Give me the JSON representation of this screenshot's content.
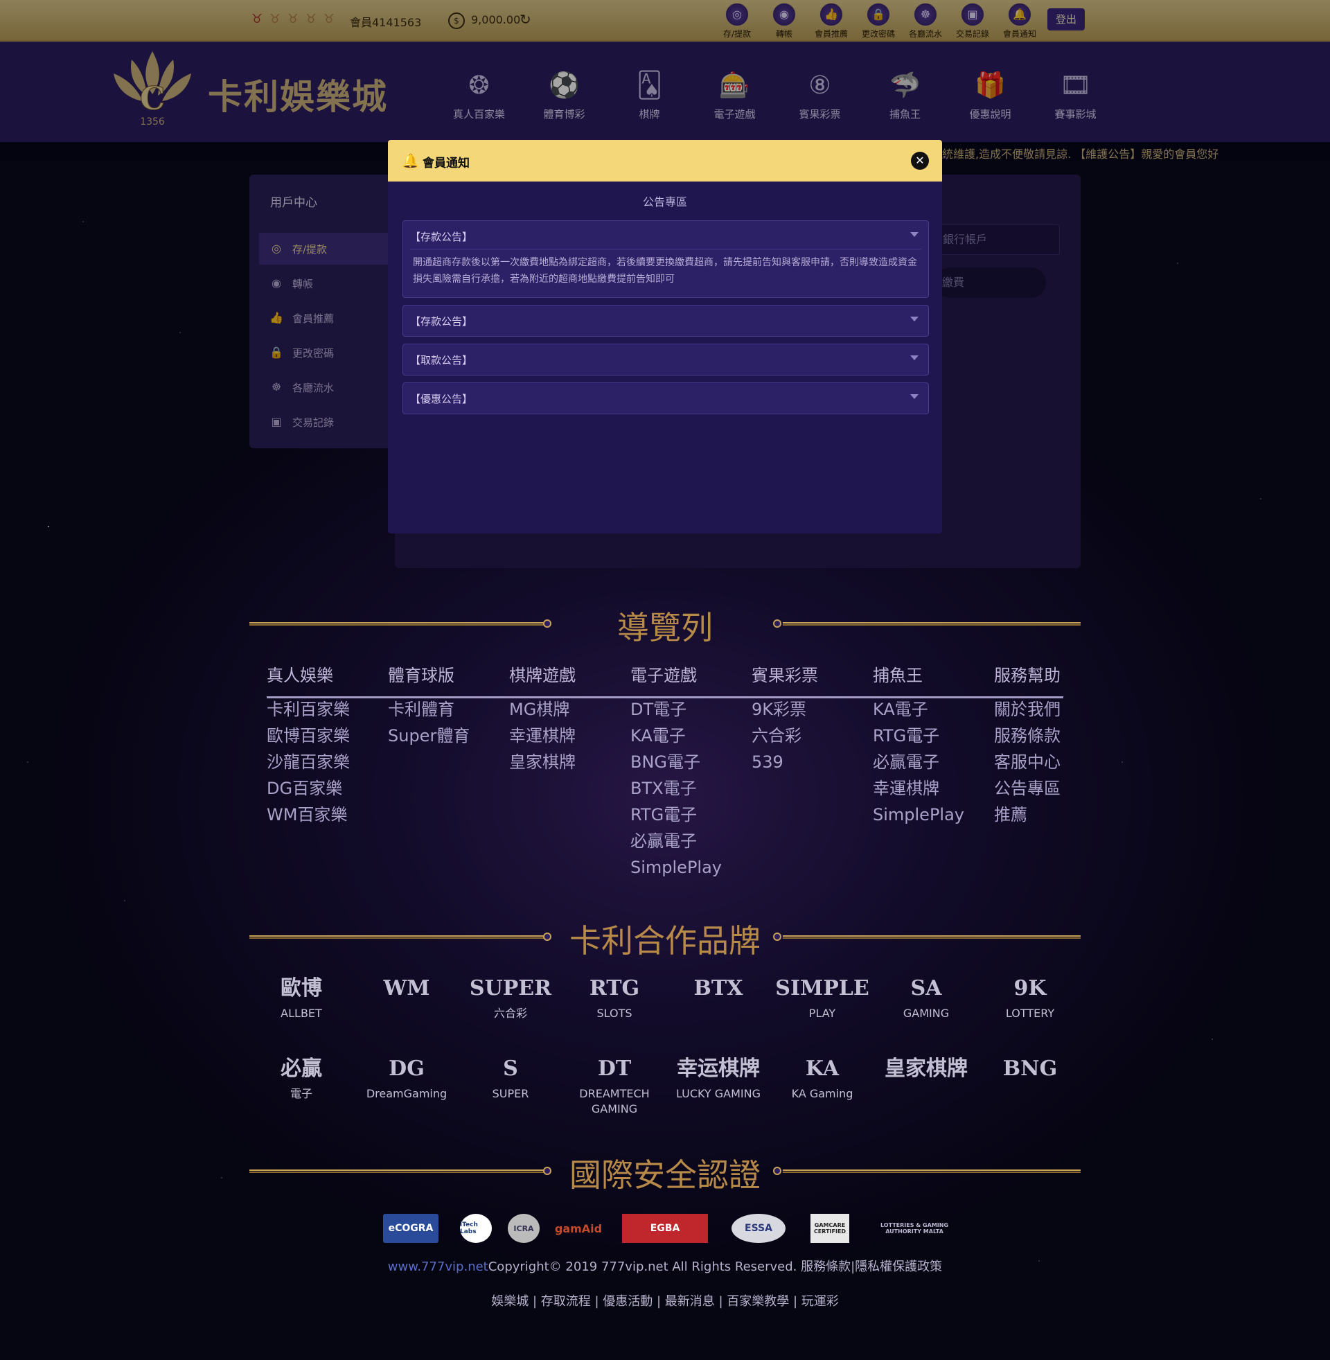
{
  "topbar": {
    "medals": [
      "♉",
      "♉",
      "♉",
      "♉",
      "♉"
    ],
    "member_id": "會員4141563",
    "balance_icon": "coin-icon",
    "balance": "9,000.00",
    "nav": [
      {
        "label": "存/提款",
        "icon": "deposit-icon",
        "glyph": "◎"
      },
      {
        "label": "轉帳",
        "icon": "transfer-icon",
        "glyph": "◉"
      },
      {
        "label": "會員推薦",
        "icon": "thumbs-up-icon",
        "glyph": "👍"
      },
      {
        "label": "更改密碼",
        "icon": "lock-icon",
        "glyph": "🔒"
      },
      {
        "label": "各廳流水",
        "icon": "stream-icon",
        "glyph": "☸"
      },
      {
        "label": "交易記錄",
        "icon": "record-icon",
        "glyph": "▣"
      },
      {
        "label": "會員通知",
        "icon": "bell-icon",
        "glyph": "🔔"
      }
    ],
    "logout": "登出"
  },
  "header": {
    "logo_text": "卡利娛樂城",
    "logo_year": "1356",
    "nav": [
      {
        "label": "真人百家樂",
        "icon": "chips-icon",
        "glyph": "❂"
      },
      {
        "label": "體育博彩",
        "icon": "soccer-ball-icon",
        "glyph": "⚽"
      },
      {
        "label": "棋牌",
        "icon": "cards-icon",
        "glyph": "🂡"
      },
      {
        "label": "電子遊戲",
        "icon": "slot-machine-icon",
        "glyph": "🎰"
      },
      {
        "label": "賓果彩票",
        "icon": "lottery-ball-icon",
        "glyph": "⑧"
      },
      {
        "label": "捕魚王",
        "icon": "shark-icon",
        "glyph": "🦈"
      },
      {
        "label": "優惠說明",
        "icon": "gift-icon",
        "glyph": "🎁"
      },
      {
        "label": "賽事影城",
        "icon": "film-reel-icon",
        "glyph": "🎞"
      }
    ]
  },
  "ticker": "統維護,造成不便敬請見諒.   【維護公告】親愛的會員您好",
  "user_center": {
    "title": "用戶中心",
    "items": [
      {
        "label": "存/提款",
        "icon": "deposit-icon",
        "glyph": "◎"
      },
      {
        "label": "轉帳",
        "icon": "transfer-icon",
        "glyph": "◉"
      },
      {
        "label": "會員推薦",
        "icon": "thumbs-up-icon",
        "glyph": "👍"
      },
      {
        "label": "更改密碼",
        "icon": "lock-icon",
        "glyph": "🔒"
      },
      {
        "label": "各廳流水",
        "icon": "stream-icon",
        "glyph": "☸"
      },
      {
        "label": "交易記錄",
        "icon": "record-icon",
        "glyph": "▣"
      }
    ],
    "bank_account_placeholder": "銀行帳戶",
    "pay_button": "繳費"
  },
  "modal": {
    "title": "會員通知",
    "section_title": "公告專區",
    "announcements": [
      {
        "header": "【存款公告】",
        "body": "開通超商存款後以第一次繳費地點為綁定超商，若後續要更換繳費超商，請先提前告知與客服申請，否則導致造成資金損失風險需自行承擔，若為附近的超商地點繳費提前告知即可"
      },
      {
        "header": "【存款公告】"
      },
      {
        "header": "【取款公告】"
      },
      {
        "header": "【優惠公告】"
      }
    ]
  },
  "footer_nav": {
    "title": "導覽列",
    "columns": [
      {
        "header": "真人娛樂",
        "items": [
          "卡利百家樂",
          "歐博百家樂",
          "沙龍百家樂",
          "DG百家樂",
          "WM百家樂"
        ]
      },
      {
        "header": "體育球版",
        "items": [
          "卡利體育",
          "Super體育"
        ]
      },
      {
        "header": "棋牌遊戲",
        "items": [
          "MG棋牌",
          "幸運棋牌",
          "皇家棋牌"
        ]
      },
      {
        "header": "電子遊戲",
        "items": [
          "DT電子",
          "KA電子",
          "BNG電子",
          "BTX電子",
          "RTG電子",
          "必贏電子",
          "SimplePlay"
        ]
      },
      {
        "header": "賓果彩票",
        "items": [
          "9K彩票",
          "六合彩",
          "539"
        ]
      },
      {
        "header": "捕魚王",
        "items": [
          "KA電子",
          "RTG電子",
          "必贏電子",
          "幸運棋牌",
          "SimplePlay"
        ]
      },
      {
        "header": "服務幫助",
        "items": [
          "關於我們",
          "服務條款",
          "客服中心",
          "公告專區",
          "推薦"
        ]
      }
    ]
  },
  "partners": {
    "title": "卡利合作品牌",
    "logos": [
      {
        "main": "歐博",
        "sub": "ALLBET"
      },
      {
        "main": "WM",
        "sub": ""
      },
      {
        "main": "SUPER",
        "sub": "六合彩"
      },
      {
        "main": "RTG",
        "sub": "SLOTS"
      },
      {
        "main": "BTX",
        "sub": ""
      },
      {
        "main": "SIMPLE",
        "sub": "PLAY"
      },
      {
        "main": "SA",
        "sub": "GAMING"
      },
      {
        "main": "9K",
        "sub": "LOTTERY"
      },
      {
        "main": "必贏",
        "sub": "電子"
      },
      {
        "main": "DG",
        "sub": "DreamGaming"
      },
      {
        "main": "S",
        "sub": "SUPER"
      },
      {
        "main": "DT",
        "sub": "DREAMTECH GAMING"
      },
      {
        "main": "幸运棋牌",
        "sub": "LUCKY GAMING"
      },
      {
        "main": "KA",
        "sub": "KA Gaming"
      },
      {
        "main": "皇家棋牌",
        "sub": ""
      },
      {
        "main": "BNG",
        "sub": ""
      }
    ]
  },
  "certs": {
    "title": "國際安全認證",
    "items": [
      "eCOGRA",
      "iTech Labs",
      "ICRA",
      "gamAid",
      "EGBA",
      "ESSA",
      "GAMCARE CERTIFIED",
      "LOTTERIES & GAMING AUTHORITY MALTA"
    ]
  },
  "copyright": {
    "link": "www.777vip.net",
    "text": "Copyright© 2019 777vip.net All Rights Reserved. 服務條款|隱私權保護政策"
  },
  "footer_links": "娛樂城 | 存取流程 | 優惠活動 | 最新消息 | 百家樂教學 | 玩運彩",
  "colors": {
    "gold": "#c9b07a",
    "accent_purple": "#2a1e5e",
    "modal_header": "#f4d778",
    "link_blue": "#5a6ec8"
  }
}
